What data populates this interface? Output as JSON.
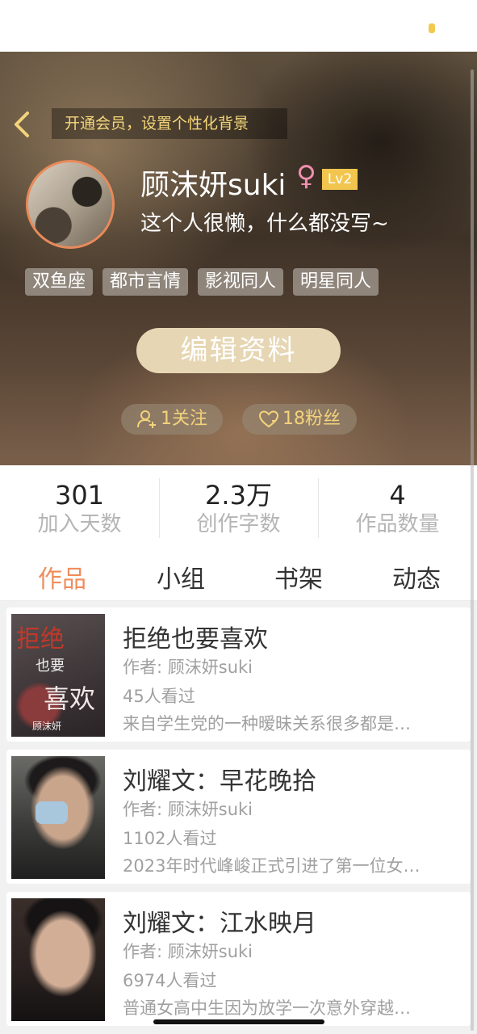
{
  "colors": {
    "accent_orange": "#ef8d5c",
    "gold_text": "#f3d37b",
    "level_badge": "#f2c64e",
    "edit_button": "#e6d6b3",
    "gender_icon": "#f08fb0"
  },
  "header": {
    "vip_banner": "开通会员，设置个性化背景",
    "back_icon": "chevron-left-icon"
  },
  "profile": {
    "username": "顾沫妍suki",
    "gender_symbol": "♀",
    "level": "Lv2",
    "bio": "这个人很懒，什么都没写~",
    "tags": [
      "双鱼座",
      "都市言情",
      "影视同人",
      "明星同人"
    ],
    "edit_button": "编辑资料",
    "following": {
      "icon": "user-plus-icon",
      "label": "1关注"
    },
    "followers": {
      "icon": "heart-icon",
      "label": "18粉丝"
    }
  },
  "stats": [
    {
      "value": "301",
      "label": "加入天数"
    },
    {
      "value": "2.3万",
      "label": "创作字数"
    },
    {
      "value": "4",
      "label": "作品数量"
    }
  ],
  "tabs": [
    {
      "label": "作品",
      "active": true
    },
    {
      "label": "小组",
      "active": false
    },
    {
      "label": "书架",
      "active": false
    },
    {
      "label": "动态",
      "active": false
    }
  ],
  "works": [
    {
      "title": "拒绝也要喜欢",
      "author": "作者: 顾沫妍suki",
      "views": "45人看过",
      "description": "来自学生党的一种暧昧关系很多都是…",
      "cover_text": {
        "line1": "拒绝",
        "line2": "也要",
        "line3": "喜欢",
        "signature": "顾沫妍"
      }
    },
    {
      "title": "刘耀文：早花晚拾",
      "author": "作者: 顾沫妍suki",
      "views": "1102人看过",
      "description": "2023年时代峰峻正式引进了第一位女…"
    },
    {
      "title": "刘耀文：江水映月",
      "author": "作者: 顾沫妍suki",
      "views": "6974人看过",
      "description": "普通女高中生因为放学一次意外穿越…"
    }
  ]
}
